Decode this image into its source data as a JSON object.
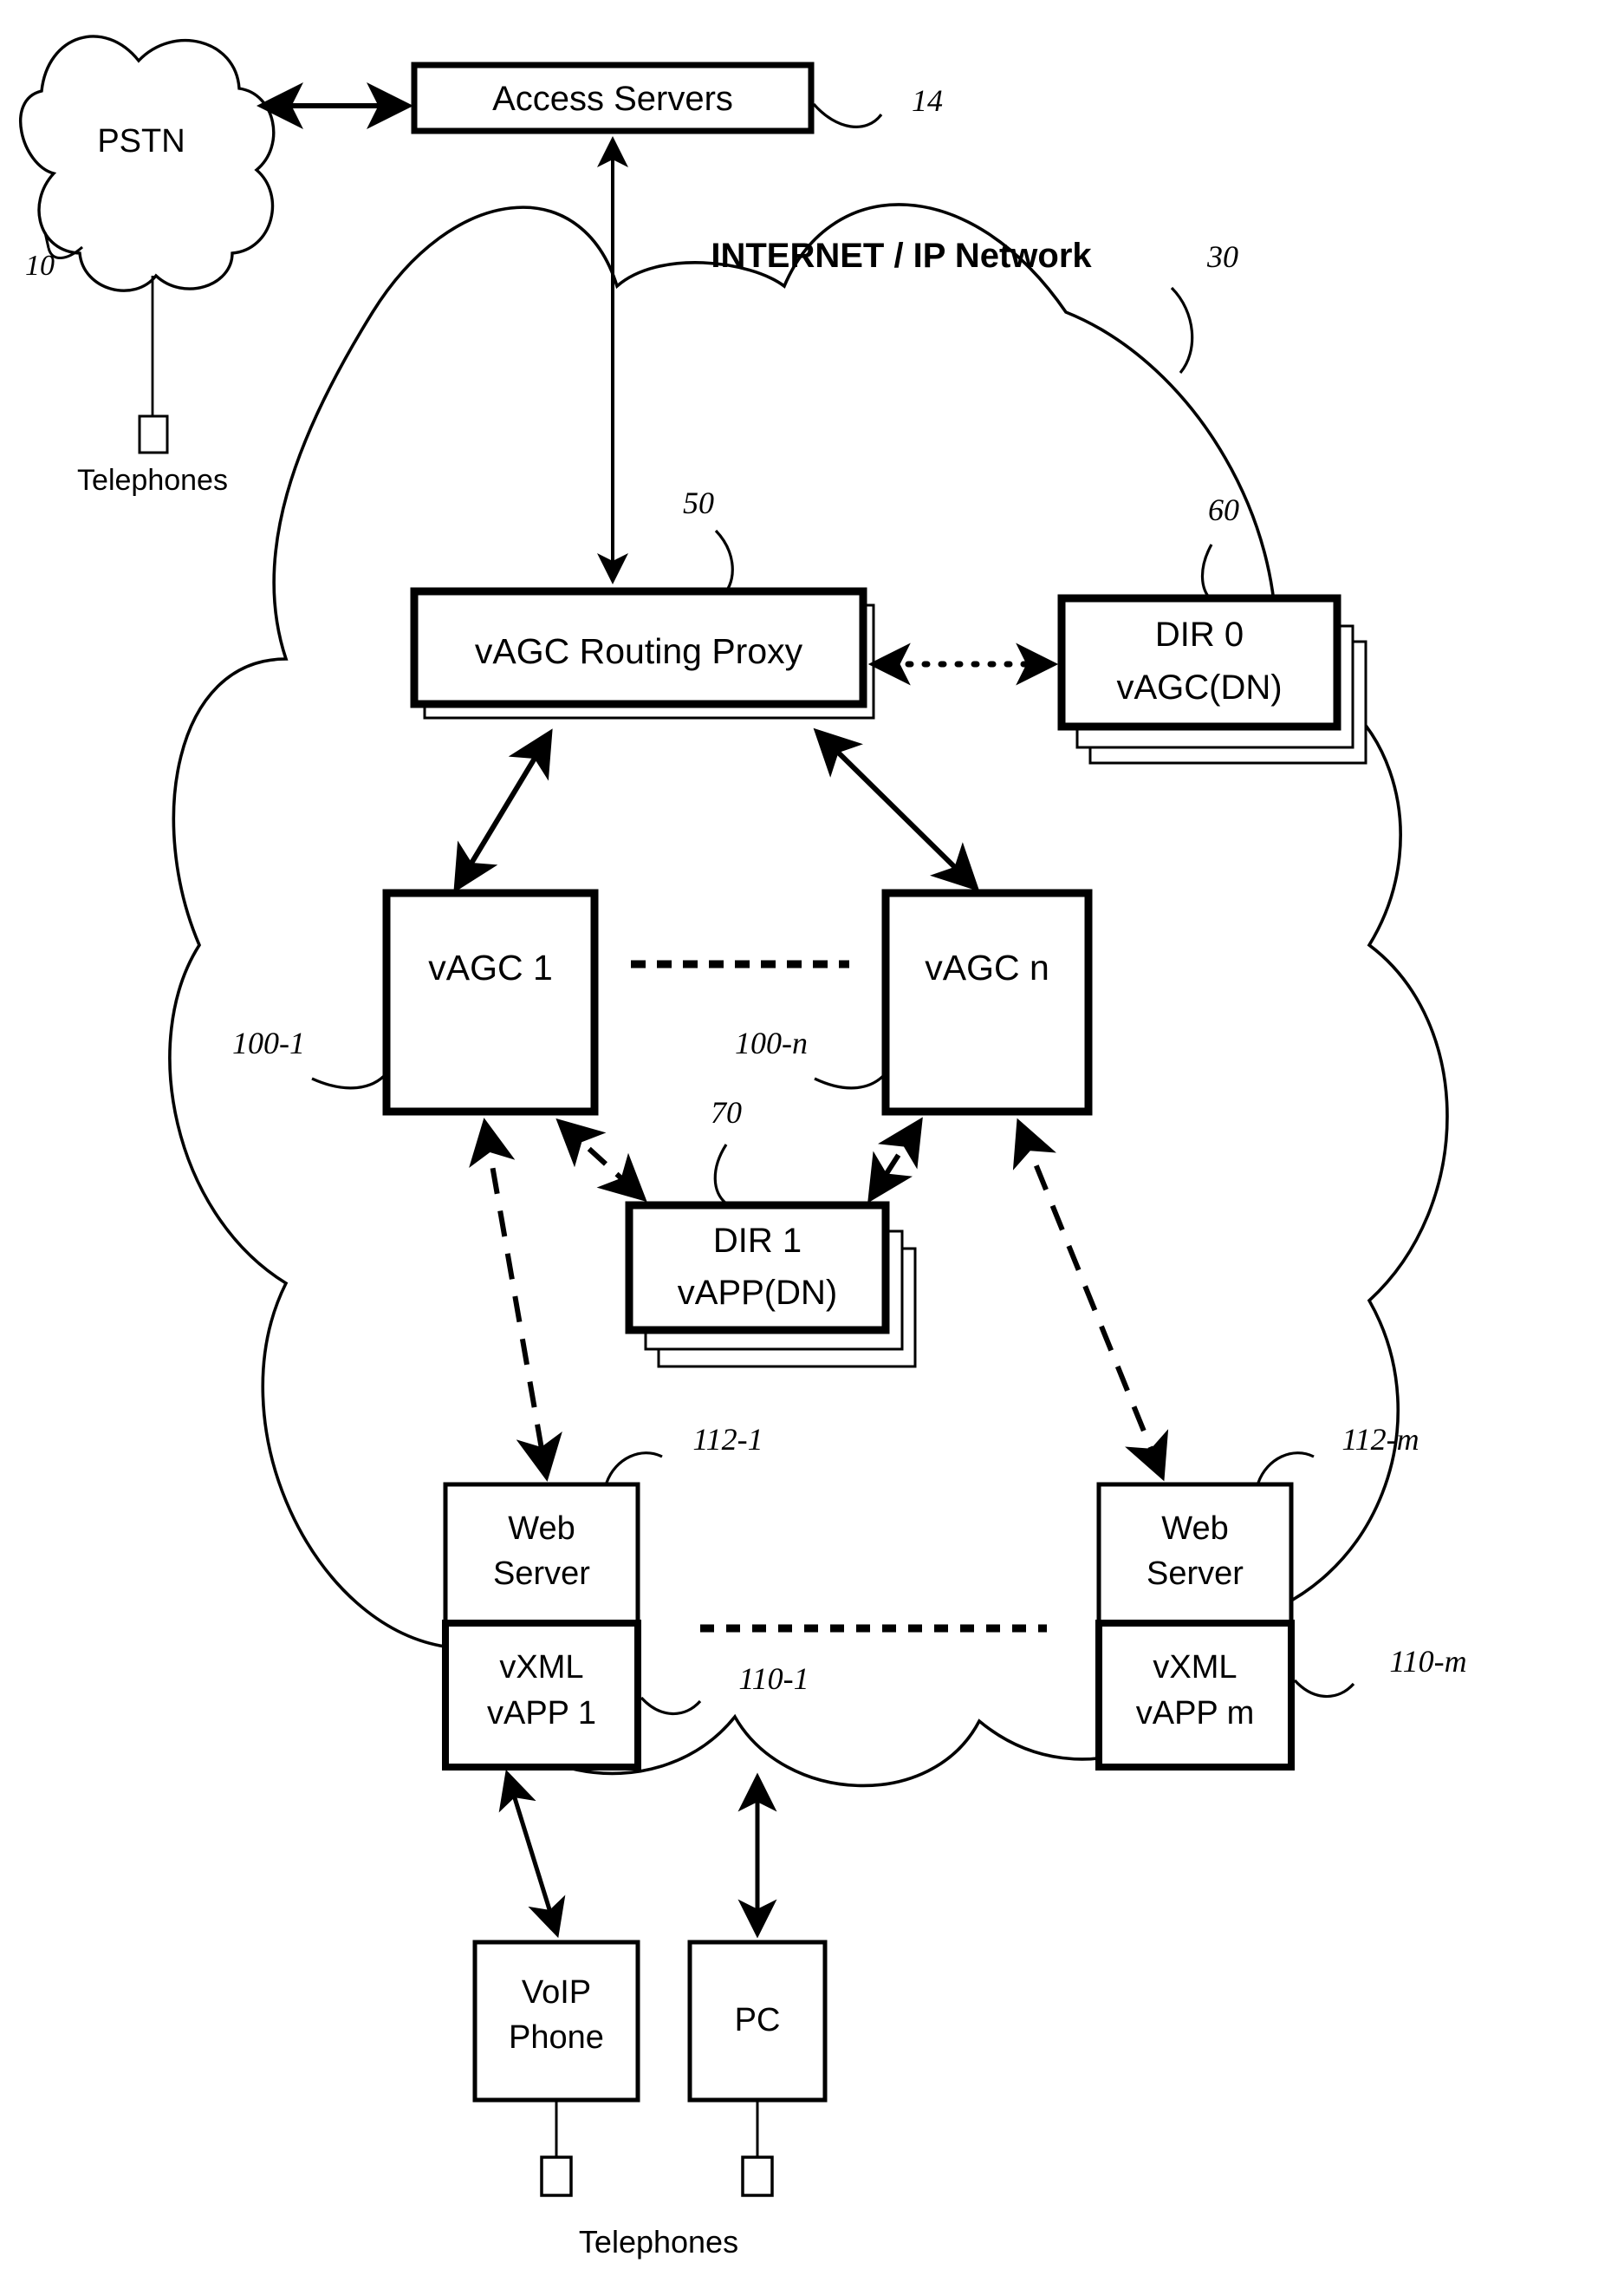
{
  "figure": {
    "type": "network-architecture-diagram",
    "background": "#ffffff",
    "stroke": "#000000"
  },
  "clouds": [
    {
      "id": "pstn",
      "label": "PSTN",
      "ref": "10"
    },
    {
      "id": "internet",
      "label": "INTERNET / IP Network",
      "ref": "30"
    }
  ],
  "nodes": {
    "access_servers": {
      "label": "Access Servers",
      "ref": "14"
    },
    "routing_proxy": {
      "label": "vAGC Routing Proxy",
      "ref": "50"
    },
    "dir0": {
      "line1": "DIR 0",
      "line2": "vAGC(DN)",
      "ref": "60"
    },
    "vagc1": {
      "label": "vAGC 1",
      "ref": "100-1"
    },
    "vagcn": {
      "label": "vAGC n",
      "ref": "100-n"
    },
    "dir1": {
      "line1": "DIR 1",
      "line2": "vAPP(DN)",
      "ref": "70"
    },
    "web_server_1": {
      "line1": "Web",
      "line2": "Server",
      "ref": "112-1"
    },
    "vapp_1": {
      "line1": "vXML",
      "line2": "vAPP 1",
      "ref": "110-1"
    },
    "web_server_m": {
      "line1": "Web",
      "line2": "Server",
      "ref": "112-m"
    },
    "vapp_m": {
      "line1": "vXML",
      "line2": "vAPP m",
      "ref": "110-m"
    },
    "voip_phone": {
      "line1": "VoIP",
      "line2": "Phone"
    },
    "pc": {
      "label": "PC"
    }
  },
  "captions": {
    "telephones_top": "Telephones",
    "telephones_bottom": "Telephones"
  },
  "reference_numerals": [
    "10",
    "14",
    "30",
    "50",
    "60",
    "70",
    "100-1",
    "100-n",
    "110-1",
    "110-m",
    "112-1",
    "112-m"
  ],
  "connectors": [
    {
      "from": "pstn",
      "to": "access_servers",
      "style": "solid",
      "arrows": "both"
    },
    {
      "from": "access_servers",
      "to": "routing_proxy",
      "style": "solid",
      "arrows": "both"
    },
    {
      "from": "routing_proxy",
      "to": "dir0",
      "style": "dotted",
      "arrows": "both"
    },
    {
      "from": "routing_proxy",
      "to": "vagc1",
      "style": "solid",
      "arrows": "both"
    },
    {
      "from": "routing_proxy",
      "to": "vagcn",
      "style": "solid",
      "arrows": "both"
    },
    {
      "from": "vagc1",
      "to": "dir1",
      "style": "dashed",
      "arrows": "both"
    },
    {
      "from": "vagcn",
      "to": "dir1",
      "style": "dashed",
      "arrows": "both"
    },
    {
      "from": "vagc1",
      "to": "web_server_1",
      "style": "dashed",
      "arrows": "both"
    },
    {
      "from": "vagcn",
      "to": "web_server_m",
      "style": "dashed",
      "arrows": "both"
    },
    {
      "from": "vapp_1",
      "to": "voip_phone",
      "style": "solid",
      "arrows": "both"
    },
    {
      "from": "vapp_1",
      "to": "pc",
      "style": "solid",
      "arrows": "both"
    }
  ],
  "ellipses": [
    {
      "between": [
        "vagc1",
        "vagcn"
      ],
      "style": "dashed-horizontal"
    },
    {
      "between": [
        "web_server_1",
        "web_server_m"
      ],
      "style": "dashed-horizontal"
    }
  ]
}
